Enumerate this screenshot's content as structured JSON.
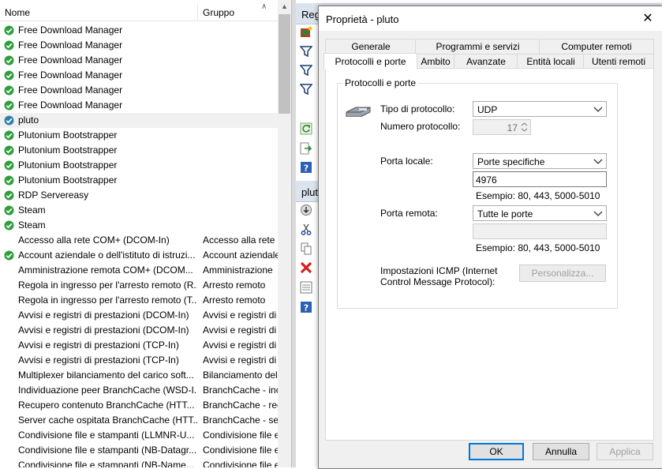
{
  "list": {
    "col_name": "Nome",
    "col_group": "Gruppo",
    "rows": [
      {
        "name": "Free Download Manager",
        "group": "",
        "icon": "enabled"
      },
      {
        "name": "Free Download Manager",
        "group": "",
        "icon": "enabled"
      },
      {
        "name": "Free Download Manager",
        "group": "",
        "icon": "enabled"
      },
      {
        "name": "Free Download Manager",
        "group": "",
        "icon": "enabled"
      },
      {
        "name": "Free Download Manager",
        "group": "",
        "icon": "enabled"
      },
      {
        "name": "Free Download Manager",
        "group": "",
        "icon": "enabled"
      },
      {
        "name": "pluto",
        "group": "",
        "icon": "selected",
        "selected": true
      },
      {
        "name": "Plutonium Bootstrapper",
        "group": "",
        "icon": "enabled"
      },
      {
        "name": "Plutonium Bootstrapper",
        "group": "",
        "icon": "enabled"
      },
      {
        "name": "Plutonium Bootstrapper",
        "group": "",
        "icon": "enabled"
      },
      {
        "name": "Plutonium Bootstrapper",
        "group": "",
        "icon": "enabled"
      },
      {
        "name": "RDP Servereasy",
        "group": "",
        "icon": "enabled"
      },
      {
        "name": "Steam",
        "group": "",
        "icon": "enabled"
      },
      {
        "name": "Steam",
        "group": "",
        "icon": "enabled"
      },
      {
        "name": "Accesso alla rete COM+ (DCOM-In)",
        "group": "Accesso alla rete C",
        "icon": "none"
      },
      {
        "name": "Account aziendale o dell'istituto di istruzi...",
        "group": "Account aziendale",
        "icon": "enabled"
      },
      {
        "name": "Amministrazione remota COM+ (DCOM...",
        "group": "Amministrazione",
        "icon": "none"
      },
      {
        "name": "Regola in ingresso per l'arresto remoto (R...",
        "group": "Arresto remoto",
        "icon": "none"
      },
      {
        "name": "Regola in ingresso per l'arresto remoto (T...",
        "group": "Arresto remoto",
        "icon": "none"
      },
      {
        "name": "Avvisi e registri di prestazioni (DCOM-In)",
        "group": "Avvisi e registri di",
        "icon": "none"
      },
      {
        "name": "Avvisi e registri di prestazioni (DCOM-In)",
        "group": "Avvisi e registri di",
        "icon": "none"
      },
      {
        "name": "Avvisi e registri di prestazioni (TCP-In)",
        "group": "Avvisi e registri di",
        "icon": "none"
      },
      {
        "name": "Avvisi e registri di prestazioni (TCP-In)",
        "group": "Avvisi e registri di",
        "icon": "none"
      },
      {
        "name": "Multiplexer bilanciamento del carico soft...",
        "group": "Bilanciamento del",
        "icon": "none"
      },
      {
        "name": "Individuazione peer BranchCache (WSD-I...",
        "group": "BranchCache - inc",
        "icon": "none"
      },
      {
        "name": "Recupero contenuto BranchCache (HTT...",
        "group": "BranchCache - rec",
        "icon": "none"
      },
      {
        "name": "Server cache ospitata BranchCache (HTT...",
        "group": "BranchCache - ser",
        "icon": "none"
      },
      {
        "name": "Condivisione file e stampanti (LLMNR-U...",
        "group": "Condivisione file e",
        "icon": "none"
      },
      {
        "name": "Condivisione file e stampanti (NB-Datagr...",
        "group": "Condivisione file e",
        "icon": "none"
      },
      {
        "name": "Condivisione file e stampanti (NB-Name...",
        "group": "Condivisione file e",
        "icon": "none"
      }
    ]
  },
  "actions": {
    "header1": "Reg",
    "header2": "plut"
  },
  "dialog": {
    "title": "Proprietà - pluto",
    "tabs_row1": [
      "Generale",
      "Programmi e servizi",
      "Computer remoti"
    ],
    "tabs_row2": [
      "Protocolli e porte",
      "Ambito",
      "Avanzate",
      "Entità locali",
      "Utenti remoti"
    ],
    "group_title": "Protocolli e porte",
    "protocol_type_label": "Tipo di protocollo:",
    "protocol_type_value": "UDP",
    "protocol_number_label": "Numero protocollo:",
    "protocol_number_value": "17",
    "local_port_label": "Porta locale:",
    "local_port_mode": "Porte specifiche",
    "local_port_value": "4976",
    "local_example": "Esempio: 80, 443, 5000-5010",
    "remote_port_label": "Porta remota:",
    "remote_port_mode": "Tutte le porte",
    "remote_port_value": "",
    "remote_example": "Esempio: 80, 443, 5000-5010",
    "icmp_label": "Impostazioni ICMP (Internet Control Message Protocol):",
    "customize_button": "Personalizza...",
    "ok_button": "OK",
    "cancel_button": "Annulla",
    "apply_button": "Applica"
  }
}
